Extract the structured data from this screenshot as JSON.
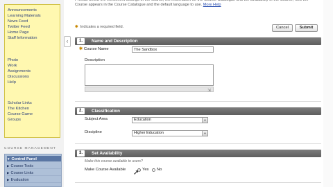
{
  "sidebar": {
    "menu_group_1": [
      "Announcements",
      "Learning Materials",
      "News Feed",
      "Twitter Feed",
      "Home Page",
      "Staff Information"
    ],
    "menu_group_2": [
      "Photo",
      "Work",
      "Assignments",
      "Discussions",
      "Help"
    ],
    "menu_group_3": [
      "Scholar Links",
      "The Kitchen",
      "Course Game",
      "Groups"
    ],
    "course_management_label": "COURSE MANAGEMENT",
    "management_items": [
      {
        "label": "Control Panel",
        "active": true
      },
      {
        "label": "Course Tools",
        "active": false
      },
      {
        "label": "Course Links",
        "active": false
      },
      {
        "label": "Evaluation",
        "active": false
      }
    ]
  },
  "intro": {
    "text": "Provide below the enrollment settings of the course, the information for the Course Catalogue and the availability of the Course, how the Course appears in the Course Catalogue and the default language to use.",
    "help_link": "More Help"
  },
  "required_note": "Indicates a required field.",
  "buttons": {
    "cancel": "Cancel",
    "submit": "Submit"
  },
  "sections": [
    {
      "number": "1.",
      "title": "Name and Description"
    },
    {
      "number": "2.",
      "title": "Classification"
    },
    {
      "number": "3.",
      "title": "Set Availability"
    }
  ],
  "form": {
    "course_name_label": "Course Name",
    "course_name_value": "The Sandbox",
    "description_label": "Description",
    "subject_area_label": "Subject Area",
    "subject_area_value": "Education",
    "discipline_label": "Discipline",
    "discipline_value": "Higher Education",
    "availability_note": "Make this course available to users?",
    "availability_label": "Make Course Available",
    "yes_label": "Yes",
    "no_label": "No",
    "availability_selected": "Yes"
  },
  "icons": {
    "required": "asterisk-icon",
    "collapse": "chevron-left-icon",
    "resize": "resize-grip-icon",
    "cursor": "mouse-pointer-icon"
  },
  "colors": {
    "menu_bg": "#fff8b0",
    "section_header": "#6b6b6b",
    "management_bg": "#aec0d8",
    "required_star": "#c88700"
  }
}
